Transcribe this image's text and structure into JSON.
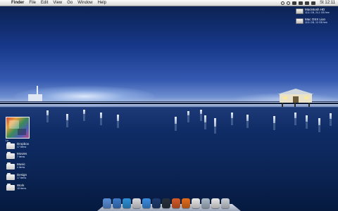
{
  "menubar": {
    "apple_glyph": "",
    "app_name": "Finder",
    "menus": [
      "File",
      "Edit",
      "View",
      "Go",
      "Window",
      "Help"
    ],
    "status_icons": [
      "display-icon",
      "timemachine-icon",
      "bluetooth-icon",
      "wifi-icon",
      "volume-icon",
      "battery-icon"
    ],
    "clock": "St 12:11"
  },
  "drives": [
    {
      "name": "Macintosh HD",
      "info": "1111 GB, 24,1 GB free"
    },
    {
      "name": "Mac OSX Lion",
      "info": "1111 GB, 13 GB free"
    }
  ],
  "album": {
    "label": "Lv"
  },
  "folders": [
    {
      "name": "Dropbox",
      "count": "17 items"
    },
    {
      "name": "Movies",
      "count": "7 items"
    },
    {
      "name": "Music",
      "count": "4 items"
    },
    {
      "name": "Design",
      "count": "17 items"
    },
    {
      "name": "Work",
      "count": "18 items"
    }
  ],
  "dock": {
    "apps": [
      {
        "name": "finder-icon",
        "color": "#5b8ed8"
      },
      {
        "name": "safari-icon",
        "color": "#3c79c6"
      },
      {
        "name": "itunes-icon",
        "color": "#2e8fd6"
      },
      {
        "name": "mail-icon",
        "color": "#d7d9de"
      },
      {
        "name": "app-store-icon",
        "color": "#3b8be0"
      },
      {
        "name": "photoshop-icon",
        "color": "#1e3b6e"
      },
      {
        "name": "terminal-icon",
        "color": "#27303b"
      },
      {
        "name": "reeder-icon",
        "color": "#d35b2a"
      },
      {
        "name": "firefox-icon",
        "color": "#e36c1e"
      },
      {
        "name": "calendar-icon",
        "color": "#e8e8e8"
      },
      {
        "name": "coda-icon",
        "color": "#a9b7c7"
      },
      {
        "name": "preview-icon",
        "color": "#e6e6e6"
      },
      {
        "name": "trash-icon",
        "color": "#c9ced6"
      }
    ]
  }
}
